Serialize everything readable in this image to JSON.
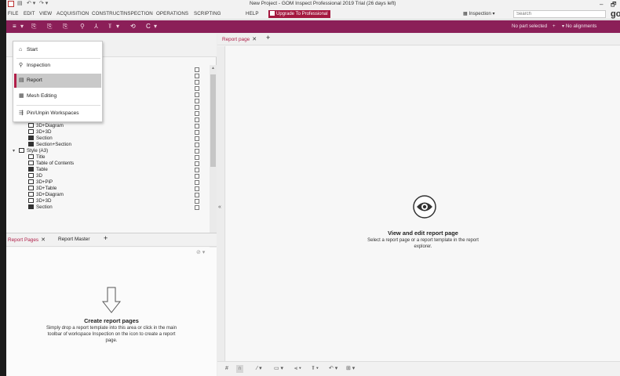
{
  "window": {
    "title": "New Project - GOM Inspect Professional 2019 Trial (26 days left)",
    "minimize": "–",
    "restore": "🗗"
  },
  "menubar": {
    "items": [
      "FILE",
      "EDIT",
      "VIEW",
      "ACQUISITION",
      "CONSTRUCT",
      "INSPECTION",
      "OPERATIONS",
      "SCRIPTING",
      "HELP"
    ],
    "upgrade_label": "Upgrade To Professional",
    "workspace_label": "Inspection",
    "search_placeholder": "Search",
    "logo": "go"
  },
  "toolbar": {
    "status_part": "No part selected",
    "status_alignment": "No alignments"
  },
  "workspace_menu": {
    "items": [
      {
        "label": "Start",
        "icon": "home-icon"
      },
      {
        "label": "Inspection",
        "icon": "magnifier-icon"
      },
      {
        "label": "Report",
        "icon": "report-icon",
        "selected": true
      },
      {
        "label": "Mesh Editing",
        "icon": "grid-icon"
      },
      {
        "label": "Pin/Unpin Workspaces",
        "icon": "pin-icon"
      }
    ]
  },
  "tree": {
    "rows": [
      {
        "label": "3D+Diagram",
        "indent": 2
      },
      {
        "label": "3D+3D",
        "indent": 2
      },
      {
        "label": "Section",
        "indent": 2
      },
      {
        "label": "Section+Section",
        "indent": 2
      },
      {
        "label": "Style (A3)",
        "indent": 0
      },
      {
        "label": "Title",
        "indent": 2
      },
      {
        "label": "Table of Contents",
        "indent": 2
      },
      {
        "label": "Table",
        "indent": 2
      },
      {
        "label": "3D",
        "indent": 2
      },
      {
        "label": "3D+PiP",
        "indent": 2
      },
      {
        "label": "3D+Table",
        "indent": 2
      },
      {
        "label": "3D+Diagram",
        "indent": 2
      },
      {
        "label": "3D+3D",
        "indent": 2
      },
      {
        "label": "Section",
        "indent": 2
      }
    ]
  },
  "bottom_panel": {
    "tabs": [
      "Report Pages",
      "Report Master"
    ],
    "add_tab": "+",
    "title": "Create report pages",
    "description": "Simply drop a report template into this area or click in the main toolbar of workspace Inspection on the icon to create a report page."
  },
  "report_view": {
    "tab": "Report page",
    "add_tab": "+",
    "collapse": "«",
    "title": "View and edit report page",
    "description": "Select a report page or a report template in the report explorer."
  },
  "colors": {
    "toolbar": "#8b1f58",
    "accent": "#b01e48"
  }
}
